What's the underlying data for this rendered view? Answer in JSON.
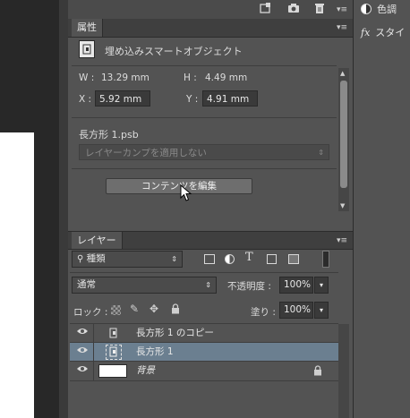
{
  "right_panel": {
    "items": [
      {
        "label": "色調",
        "icon": "adjustment-circle-icon"
      },
      {
        "label": "スタイ",
        "icon": "fx-icon"
      }
    ]
  },
  "toolbar": {
    "icons": [
      "new-item-icon",
      "camera-icon",
      "trash-icon",
      "panel-menu-icon"
    ]
  },
  "properties": {
    "tab_label": "属性",
    "object_type": "埋め込みスマートオブジェクト",
    "w_label": "W :",
    "w_value": "13.29 mm",
    "h_label": "H :",
    "h_value": "4.49 mm",
    "x_label": "X :",
    "x_value": "5.92 mm",
    "y_label": "Y :",
    "y_value": "4.91 mm",
    "filename": "長方形 1.psb",
    "comp_dropdown": "レイヤーカンプを適用しない",
    "edit_button": "コンテンツを編集"
  },
  "layers": {
    "tab_label": "レイヤー",
    "filter_select": "種類",
    "blend_mode": "通常",
    "opacity_label": "不透明度 :",
    "opacity_value": "100%",
    "lock_label": "ロック :",
    "fill_label": "塗り :",
    "fill_value": "100%",
    "rows": [
      {
        "name": "長方形 1 のコピー",
        "selected": false,
        "type": "smart-object"
      },
      {
        "name": "長方形 1",
        "selected": true,
        "type": "smart-object"
      },
      {
        "name": "背景",
        "selected": false,
        "type": "background",
        "locked": true
      }
    ]
  },
  "colors": {
    "panel_bg": "#535353",
    "selected_row": "#6b7f90",
    "field_bg": "#3a3a3a"
  }
}
